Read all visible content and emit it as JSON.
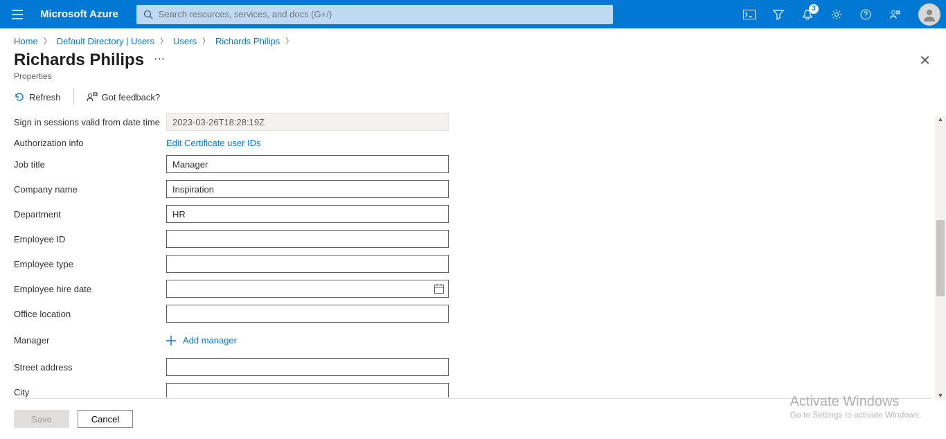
{
  "brand": "Microsoft Azure",
  "search": {
    "placeholder": "Search resources, services, and docs (G+/)"
  },
  "notifications_badge": "3",
  "breadcrumb": {
    "items": [
      "Home",
      "Default Directory | Users",
      "Users",
      "Richards Philips"
    ]
  },
  "title": "Richards Philips",
  "subtitle": "Properties",
  "toolbar": {
    "refresh": "Refresh",
    "feedback": "Got feedback?"
  },
  "form": {
    "sign_in_sessions_label": "Sign in sessions valid from date time",
    "sign_in_sessions_value": "2023-03-26T18:28:19Z",
    "auth_info_label": "Authorization info",
    "auth_info_link": "Edit Certificate user IDs",
    "job_title_label": "Job title",
    "job_title_value": "Manager",
    "company_label": "Company name",
    "company_value": "Inspiration",
    "department_label": "Department",
    "department_value": "HR",
    "employee_id_label": "Employee ID",
    "employee_id_value": "",
    "employee_type_label": "Employee type",
    "employee_type_value": "",
    "employee_hire_label": "Employee hire date",
    "employee_hire_value": "",
    "office_location_label": "Office location",
    "office_location_value": "",
    "manager_label": "Manager",
    "add_manager": "Add manager",
    "street_label": "Street address",
    "street_value": "",
    "city_label": "City",
    "city_value": ""
  },
  "footer": {
    "save": "Save",
    "cancel": "Cancel"
  },
  "watermark": {
    "line1": "Activate Windows",
    "line2": "Go to Settings to activate Windows."
  }
}
